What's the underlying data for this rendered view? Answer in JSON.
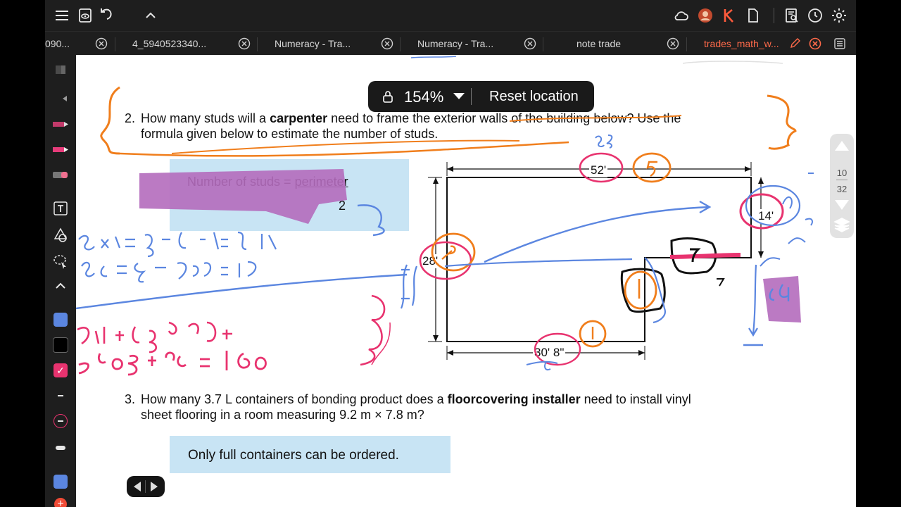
{
  "tabs": [
    {
      "label": "090...",
      "active": false
    },
    {
      "label": "4_5940523340...",
      "active": false
    },
    {
      "label": "Numeracy - Tra...",
      "active": false
    },
    {
      "label": "Numeracy - Tra...",
      "active": false
    },
    {
      "label": "note trade",
      "active": false
    },
    {
      "label": "trades_math_w...",
      "active": true
    }
  ],
  "zoom": {
    "value": "154%",
    "reset_label": "Reset location"
  },
  "question2": {
    "number": "2.",
    "text_a": "How many studs will a ",
    "bold": "carpenter",
    "text_b": " need to frame the exterior walls of the building below? Use the",
    "line2": "formula given below to estimate the number of studs."
  },
  "formula": {
    "lhs": "Number of studs = ",
    "numerator": "perimeter",
    "denominator": "2"
  },
  "diagram": {
    "top_dim": "52'",
    "right_dim": "14'",
    "left_dim": "28'",
    "bottom_dim": "30' 8\""
  },
  "question3": {
    "number": "3.",
    "text_a": "How many 3.7 L containers of bonding product does a ",
    "bold": "floorcovering installer",
    "text_b": " need to install vinyl",
    "line2": "sheet flooring in a room measuring 9.2 m × 7.8 m?"
  },
  "note": {
    "text": "Only full containers can be ordered."
  },
  "page_indicator": {
    "current": "10",
    "total": "32"
  },
  "colors": {
    "accent": "#ff6a4a",
    "pen_blue": "#5b86e0",
    "pen_pink": "#e8336f",
    "pen_orange": "#f07e1c",
    "highlight_blue": "#c8e4f4",
    "highlight_purple": "#b46cbc"
  }
}
